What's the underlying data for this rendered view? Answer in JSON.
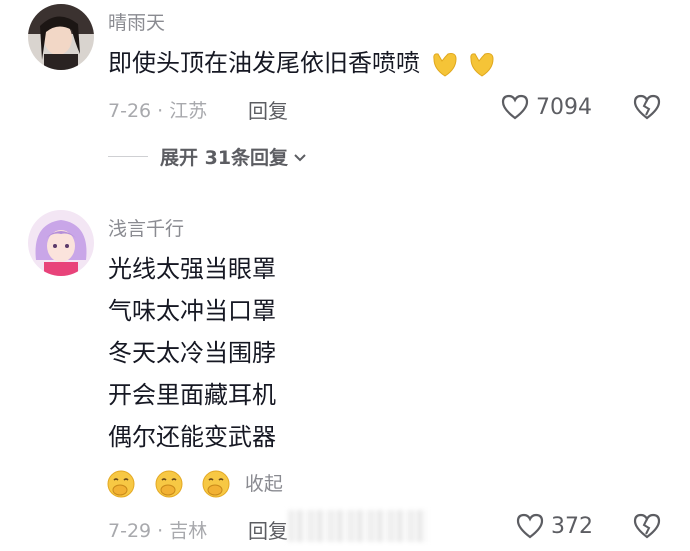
{
  "comments": [
    {
      "username": "晴雨天",
      "text_lines": [
        "即使头顶在油发尾依旧香喷喷"
      ],
      "emoji_after": [
        "yellow-heart-hands-emoji",
        "yellow-heart-hands-emoji"
      ],
      "date_location": "7-26 · 江苏",
      "reply_label": "回复",
      "like_count": "7094",
      "expand_label": "展开 31条回复",
      "avatar_icon": "girl-avatar"
    },
    {
      "username": "浅言千行",
      "text_lines": [
        "光线太强当眼罩",
        "气味太冲当口罩",
        "冬天太冷当围脖",
        "开会里面藏耳机",
        "偶尔还能变武器"
      ],
      "emoji_row": [
        "hand-over-mouth-emoji",
        "hand-over-mouth-emoji",
        "hand-over-mouth-emoji"
      ],
      "collapse_label": "收起",
      "date_location": "7-29 · 吉林",
      "reply_label": "回复",
      "like_count": "372",
      "avatar_icon": "anime-girl-avatar"
    }
  ],
  "colors": {
    "text": "#161823",
    "meta": "#a8a9ad",
    "username": "#8a8b91",
    "emoji_yellow": "#f5c437"
  }
}
